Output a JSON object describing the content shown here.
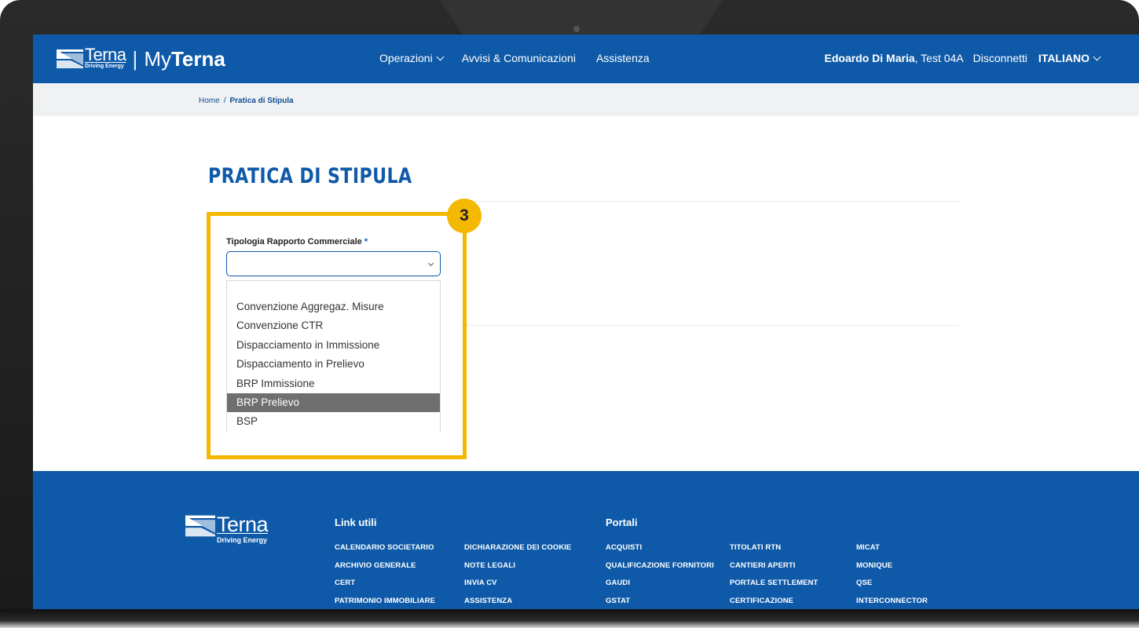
{
  "header": {
    "logo_word": "Terna",
    "logo_sub": "Driving Energy",
    "logo_separator": "|",
    "logo_my": "My",
    "logo_product": "Terna",
    "nav": [
      {
        "label": "Operazioni",
        "has_dropdown": true
      },
      {
        "label": "Avvisi & Comunicazioni"
      },
      {
        "label": "Assistenza"
      }
    ],
    "user_name": "Edoardo Di Maria",
    "user_company": ", Test 04A",
    "logout_label": "Disconnetti",
    "language": "ITALIANO"
  },
  "breadcrumb": {
    "home": "Home",
    "separator": "/",
    "current": "Pratica di Stipula"
  },
  "page": {
    "title": "PRATICA DI STIPULA"
  },
  "form": {
    "field_label": "Tipologia Rapporto Commerciale",
    "required_mark": "*",
    "select_value": "",
    "options": [
      "",
      "Convenzione Aggregaz. Misure",
      "Convenzione CTR",
      "Dispacciamento in Immissione",
      "Dispacciamento in Prelievo",
      "BRP Immissione",
      "BRP Prelievo",
      "BSP"
    ],
    "highlighted_option": "BRP Prelievo"
  },
  "annotation": {
    "step_number": "3",
    "color": "#f4b800"
  },
  "footer": {
    "logo_word": "Terna",
    "logo_sub": "Driving Energy",
    "link_utili_title": "Link utili",
    "portali_title": "Portali",
    "link_utili_col1": [
      "CALENDARIO SOCIETARIO",
      "ARCHIVIO GENERALE",
      "CERT",
      "PATRIMONIO IMMOBILIARE"
    ],
    "link_utili_col2": [
      "DICHIARAZIONE DEI COOKIE",
      "NOTE LEGALI",
      "INVIA CV",
      "ASSISTENZA"
    ],
    "portali_col1": [
      "ACQUISTI",
      "QUALIFICAZIONE FORNITORI",
      "GAUDI",
      "GSTAT"
    ],
    "portali_col2": [
      "TITOLATI RTN",
      "CANTIERI APERTI",
      "PORTALE SETTLEMENT",
      "CERTIFICAZIONE"
    ],
    "portali_col3": [
      "MICAT",
      "MONIQUE",
      "QSE",
      "INTERCONNECTOR"
    ]
  },
  "colors": {
    "brand_blue": "#0f5aa8",
    "highlight_yellow": "#f4b800",
    "selected_option_bg": "#6f6f6f"
  }
}
